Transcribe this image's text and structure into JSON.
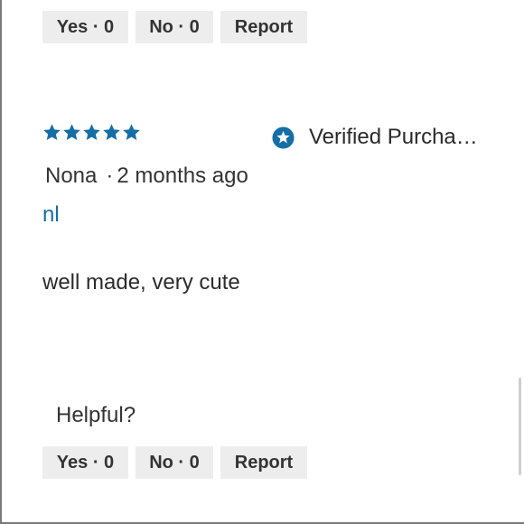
{
  "review_prev": {
    "actions": {
      "yes_label": "Yes · 0",
      "no_label": "No · 0",
      "report_label": "Report"
    }
  },
  "review": {
    "rating": 5,
    "rating_max": 5,
    "verified_label": "Verified Purcha…",
    "author": "Nona",
    "separator": "·",
    "time_ago": "2 months ago",
    "title": "nl",
    "body": "well made, very cute",
    "helpful_label": "Helpful?",
    "actions": {
      "yes_label": "Yes · 0",
      "no_label": "No · 0",
      "report_label": "Report"
    }
  },
  "colors": {
    "accent": "#166ea6",
    "button_bg": "#ededed",
    "text": "#333333"
  },
  "icons": {
    "rating": "star-icon",
    "verified": "verified-badge-icon"
  }
}
